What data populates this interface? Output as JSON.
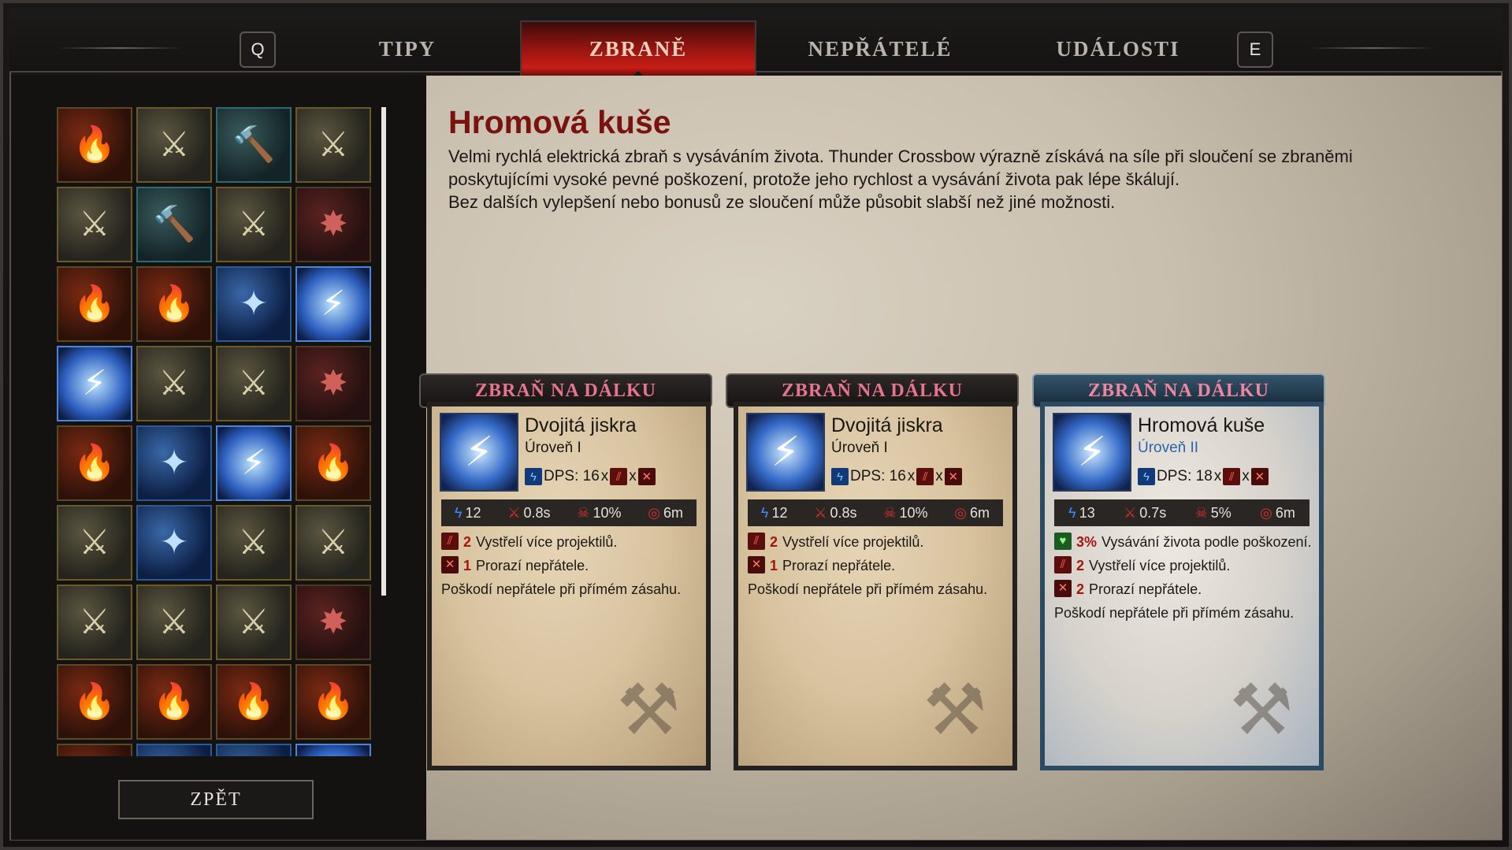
{
  "nav": {
    "key_left": "Q",
    "key_right": "E",
    "tabs": [
      {
        "label": "TIPY",
        "active": false
      },
      {
        "label": "ZBRANĚ",
        "active": true
      },
      {
        "label": "NEPŘÁTELÉ",
        "active": false
      },
      {
        "label": "UDÁLOSTI",
        "active": false
      }
    ]
  },
  "weapon_grid": {
    "cells": [
      {
        "icon": "flame-sword-icon",
        "style": "orange"
      },
      {
        "icon": "spear-icon",
        "style": "gold"
      },
      {
        "icon": "hammer-icon",
        "style": "teal"
      },
      {
        "icon": "shotgun-icon",
        "style": "gold"
      },
      {
        "icon": "chain-flail-icon",
        "style": "gold"
      },
      {
        "icon": "rifle-glow-icon",
        "style": "teal"
      },
      {
        "icon": "minigun-glow-icon",
        "style": "gold"
      },
      {
        "icon": "dynamite-icon",
        "style": "darkred"
      },
      {
        "icon": "fire-launcher-icon",
        "style": "orange"
      },
      {
        "icon": "fire-crossbow-icon",
        "style": "orange"
      },
      {
        "icon": "blue-launcher-icon",
        "style": "blue"
      },
      {
        "icon": "lightning-crossbow-icon",
        "style": "lightning"
      },
      {
        "icon": "blue-cannon-icon",
        "style": "lightning"
      },
      {
        "icon": "gatling-icon",
        "style": "gold"
      },
      {
        "icon": "crossbow-icon",
        "style": "gold"
      },
      {
        "icon": "red-rifle-icon",
        "style": "darkred"
      },
      {
        "icon": "fire-pistol-icon",
        "style": "orange"
      },
      {
        "icon": "blue-blaster-icon",
        "style": "blue"
      },
      {
        "icon": "blue-rifle-icon",
        "style": "lightning"
      },
      {
        "icon": "flame-spear-icon",
        "style": "orange"
      },
      {
        "icon": "gold-spear-icon",
        "style": "gold"
      },
      {
        "icon": "blue-hammer-icon",
        "style": "blue"
      },
      {
        "icon": "gold-shotgun-icon",
        "style": "gold"
      },
      {
        "icon": "gold-smg-icon",
        "style": "gold"
      },
      {
        "icon": "heavy-gun-icon",
        "style": "gold"
      },
      {
        "icon": "sniper-icon",
        "style": "gold"
      },
      {
        "icon": "launcher-icon",
        "style": "gold"
      },
      {
        "icon": "fire-wheel-icon",
        "style": "darkred"
      },
      {
        "icon": "flame-shotgun-icon",
        "style": "orange"
      },
      {
        "icon": "flame-crossbow-icon",
        "style": "orange"
      },
      {
        "icon": "flame-launcher-icon",
        "style": "orange"
      },
      {
        "icon": "flame-rifle-icon",
        "style": "orange"
      },
      {
        "icon": "partial-red-icon",
        "style": "orange"
      },
      {
        "icon": "partial-blue-icon",
        "style": "blue"
      },
      {
        "icon": "partial-blue2-icon",
        "style": "blue"
      },
      {
        "icon": "partial-lightning-icon",
        "style": "lightning"
      }
    ],
    "glyphs": {
      "orange": "🔥",
      "gold": "⚔",
      "teal": "🔨",
      "blue": "✦",
      "lightning": "⚡",
      "darkred": "✸"
    },
    "scroll_position": 0.0
  },
  "back_button": "ZPĚT",
  "detail": {
    "title": "Hromová kuše",
    "description": [
      "Velmi rychlá elektrická zbraň s vysáváním života. Thunder Crossbow výrazně získává na síle při sloučení se zbraněmi",
      "poskytujícími vysoké pevné poškození, protože jeho rychlost a vysávání života pak lépe škálují.",
      "Bez dalších vylepšení nebo bonusů ze sloučení může působit slabší než jiné možnosti."
    ]
  },
  "cards": [
    {
      "banner": "ZBRAŇ NA DÁLKU",
      "name": "Dvojitá jiskra",
      "level": "Úroveň I",
      "dps_label": "DPS: 16",
      "dps_x1": "x",
      "dps_x2": "x",
      "stats": {
        "damage": "12",
        "cooldown": "0.8s",
        "crit": "10%",
        "range": "6m"
      },
      "effects": [
        {
          "icon": "multi-projectile-icon",
          "num": "2",
          "text": "Vystřelí více projektilů."
        },
        {
          "icon": "pierce-icon",
          "num": "1",
          "text": "Prorazí nepřátele."
        }
      ],
      "footer": "Poškodí nepřátele při přímém zásahu.",
      "legend": false
    },
    {
      "banner": "ZBRAŇ NA DÁLKU",
      "name": "Dvojitá jiskra",
      "level": "Úroveň I",
      "dps_label": "DPS: 16",
      "dps_x1": "x",
      "dps_x2": "x",
      "stats": {
        "damage": "12",
        "cooldown": "0.8s",
        "crit": "10%",
        "range": "6m"
      },
      "effects": [
        {
          "icon": "multi-projectile-icon",
          "num": "2",
          "text": "Vystřelí více projektilů."
        },
        {
          "icon": "pierce-icon",
          "num": "1",
          "text": "Prorazí nepřátele."
        }
      ],
      "footer": "Poškodí nepřátele při přímém zásahu.",
      "legend": false
    },
    {
      "banner": "ZBRAŇ NA DÁLKU",
      "name": "Hromová kuše",
      "level": "Úroveň II",
      "dps_label": "DPS: 18",
      "dps_x1": "x",
      "dps_x2": "x",
      "stats": {
        "damage": "13",
        "cooldown": "0.7s",
        "crit": "5%",
        "range": "6m"
      },
      "lifesteal": {
        "num": "3%",
        "text": "Vysávání života podle poškození."
      },
      "effects": [
        {
          "icon": "multi-projectile-icon",
          "num": "2",
          "text": "Vystřelí více projektilů."
        },
        {
          "icon": "pierce-icon",
          "num": "2",
          "text": "Prorazí nepřátele."
        }
      ],
      "footer": "Poškodí nepřátele při přímém zásahu.",
      "legend": true
    }
  ]
}
